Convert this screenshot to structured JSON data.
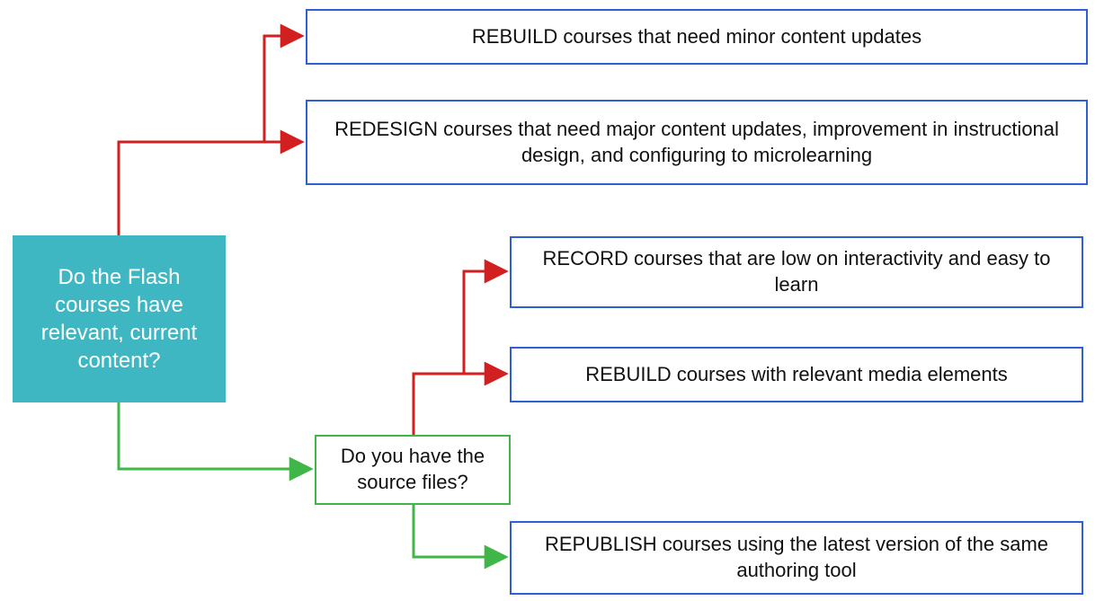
{
  "q1_text": "Do the Flash courses have relevant, current content?",
  "q2_text": "Do you have the source files?",
  "o1_text": "REBUILD courses that need minor content updates",
  "o2_text": "REDESIGN courses that need major content updates, improvement in instructional design, and configuring to microlearning",
  "o3_text": "RECORD courses that are low on interactivity and easy to learn",
  "o4_text": "REBUILD courses with relevant media elements",
  "o5_text": "REPUBLISH courses using the latest version of the same authoring tool",
  "colors": {
    "red": "#d21f1f",
    "green": "#3fb647",
    "blue": "#2f5fd0",
    "teal": "#3fb7c2"
  }
}
